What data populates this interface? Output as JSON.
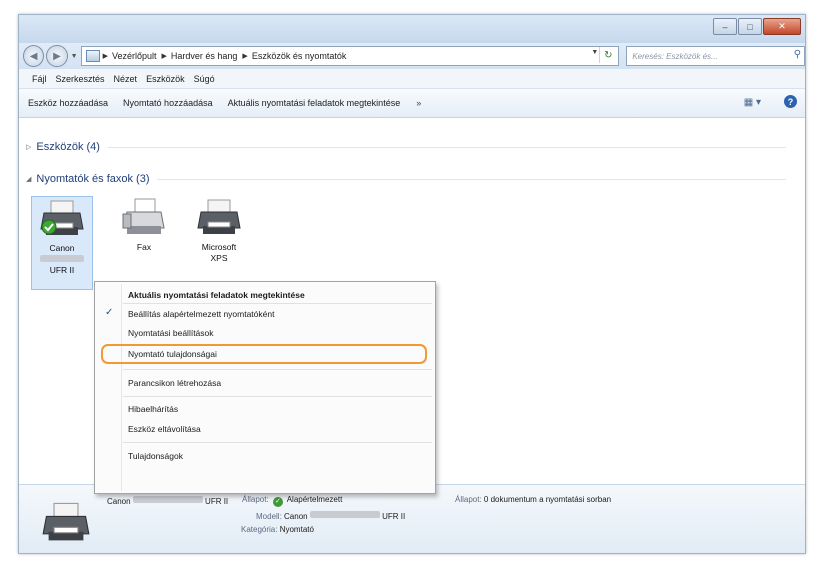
{
  "breadcrumb": [
    "Vezérlőpult",
    "Hardver és hang",
    "Eszközök és nyomtatók"
  ],
  "search": {
    "placeholder": "Keresés: Eszközök és..."
  },
  "menu": [
    "Fájl",
    "Szerkesztés",
    "Nézet",
    "Eszközök",
    "Súgó"
  ],
  "commands": [
    "Eszköz hozzáadása",
    "Nyomtató hozzáadása",
    "Aktuális nyomtatási feladatok megtekintése"
  ],
  "command_more": "»",
  "groups": {
    "devices": "Eszközök (4)",
    "printers": "Nyomtatók és faxok (3)"
  },
  "printers": [
    {
      "name": "Canon",
      "sub": "UFR II",
      "icon": "printer-default-icon"
    },
    {
      "name": "Fax",
      "icon": "fax-icon"
    },
    {
      "name": "Microsoft",
      "sub": "XPS",
      "icon": "printer-icon"
    }
  ],
  "context_menu": {
    "items": [
      "Aktuális nyomtatási feladatok megtekintése",
      "Beállítás alapértelmezett nyomtatóként",
      "Nyomtatási beállítások",
      "Nyomtató tulajdonságai",
      "Parancsikon létrehozása",
      "Hibaelhárítás",
      "Eszköz eltávolítása",
      "Tulajdonságok"
    ],
    "checked": "Beállítás alapértelmezett nyomtatóként",
    "highlighted": "Nyomtató tulajdonságai"
  },
  "details": {
    "name_prefix": "Canon",
    "name_suffix": "UFR II",
    "status_label": "Állapot:",
    "status_value": "Alapértelmezett",
    "queue_label": "Állapot:",
    "queue_value": "0 dokumentum a nyomtatási sorban",
    "model_label": "Modell:",
    "model_prefix": "Canon",
    "model_suffix": "UFR II",
    "category_label": "Kategória:",
    "category_value": "Nyomtató"
  },
  "colors": {
    "accent": "#1f3f78",
    "highlight": "#ef9a32",
    "selection": "#d9e9fa"
  }
}
